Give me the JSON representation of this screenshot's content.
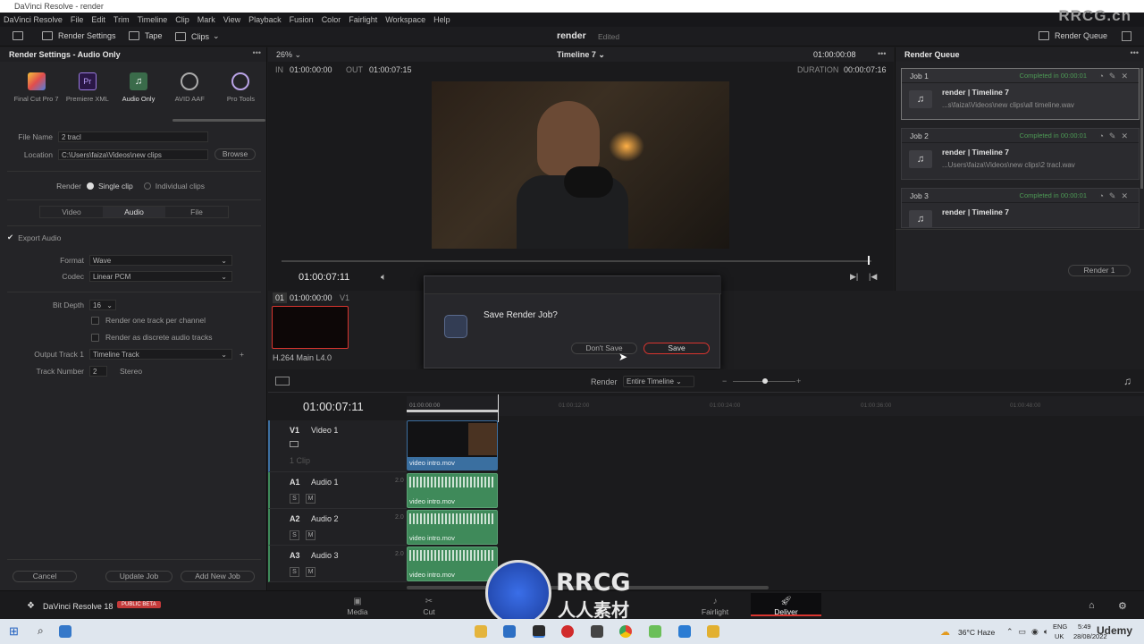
{
  "window": {
    "title": "DaVinci Resolve - render"
  },
  "menu": [
    "DaVinci Resolve",
    "File",
    "Edit",
    "Trim",
    "Timeline",
    "Clip",
    "Mark",
    "View",
    "Playback",
    "Fusion",
    "Color",
    "Fairlight",
    "Workspace",
    "Help"
  ],
  "watermark": "RRCG.cn",
  "toolbar": {
    "render_settings": "Render Settings",
    "tape": "Tape",
    "clips": "Clips",
    "project": "render",
    "edited": "Edited",
    "render_queue": "Render Queue"
  },
  "render_settings": {
    "title": "Render Settings - Audio Only",
    "presets": [
      "Final Cut Pro 7",
      "Premiere XML",
      "Audio Only",
      "AVID AAF",
      "Pro Tools"
    ],
    "file_name_label": "File Name",
    "file_name": "2 tracl",
    "location_label": "Location",
    "location": "C:\\Users\\faiza\\Videos\\new clips",
    "browse": "Browse",
    "render_label": "Render",
    "single_clip": "Single clip",
    "individual_clips": "Individual clips",
    "tabs": [
      "Video",
      "Audio",
      "File"
    ],
    "export_audio": "Export Audio",
    "format_label": "Format",
    "format": "Wave",
    "codec_label": "Codec",
    "codec": "Linear PCM",
    "bit_depth_label": "Bit Depth",
    "bit_depth": "16",
    "one_track": "Render one track per channel",
    "discrete": "Render as discrete audio tracks",
    "output_track_label": "Output Track 1",
    "output_track": "Timeline Track",
    "track_number_label": "Track Number",
    "track_number": "2",
    "stereo": "Stereo",
    "cancel": "Cancel",
    "update_job": "Update Job",
    "add_new_job": "Add New Job"
  },
  "viewer": {
    "zoom": "26%",
    "timeline": "Timeline 7",
    "timecode_top": "01:00:00:08",
    "in_label": "IN",
    "in": "01:00:00:00",
    "out_label": "OUT",
    "out": "01:00:07:15",
    "duration_label": "DURATION",
    "duration": "00:00:07:16",
    "current": "01:00:07:11"
  },
  "render_queue": {
    "title": "Render Queue",
    "jobs": [
      {
        "name": "Job 1",
        "status": "Completed in 00:00:01",
        "title": "render | Timeline 7",
        "path": "...s\\faiza\\Videos\\new clips\\all timeline.wav"
      },
      {
        "name": "Job 2",
        "status": "Completed in 00:00:01",
        "title": "render | Timeline 7",
        "path": "...Users\\faiza\\Videos\\new clips\\2 tracl.wav"
      },
      {
        "name": "Job 3",
        "status": "Completed in 00:00:01",
        "title": "render | Timeline 7",
        "path": ""
      }
    ],
    "render_button": "Render 1"
  },
  "clip_thumb": {
    "index": "01",
    "tc": "01:00:00:00",
    "track": "V1",
    "codec": "H.264 Main L4.0"
  },
  "dialog": {
    "title": "Save Render Job?",
    "dont_save": "Don't Save",
    "save": "Save"
  },
  "timeline": {
    "render_label": "Render",
    "render_value": "Entire Timeline",
    "current": "01:00:07:11",
    "ruler": [
      "01:00:00:00",
      "01:00:12:00",
      "01:00:24:00",
      "01:00:36:00",
      "01:00:48:00"
    ],
    "tracks": [
      {
        "id": "V1",
        "name": "Video 1",
        "sub": "1 Clip",
        "clip": "video intro.mov"
      },
      {
        "id": "A1",
        "name": "Audio 1",
        "ch": "2.0",
        "clip": "video intro.mov"
      },
      {
        "id": "A2",
        "name": "Audio 2",
        "ch": "2.0",
        "clip": "video intro.mov"
      },
      {
        "id": "A3",
        "name": "Audio 3",
        "ch": "2.0",
        "clip": "video intro.mov"
      }
    ],
    "solo": "S",
    "mute": "M"
  },
  "pages": {
    "app": "DaVinci Resolve 18",
    "beta": "PUBLIC BETA",
    "items": [
      "Media",
      "Cut",
      "Edit",
      "Fusion",
      "Color",
      "Fairlight",
      "Deliver"
    ],
    "active": "Deliver"
  },
  "taskbar": {
    "weather": "36°C  Haze",
    "lang1": "ENG",
    "lang2": "UK",
    "time": "5:49",
    "date": "28/08/2022",
    "brand": "Udemy"
  },
  "logo_text": {
    "top": "RRCG",
    "bottom": "人人素材"
  }
}
